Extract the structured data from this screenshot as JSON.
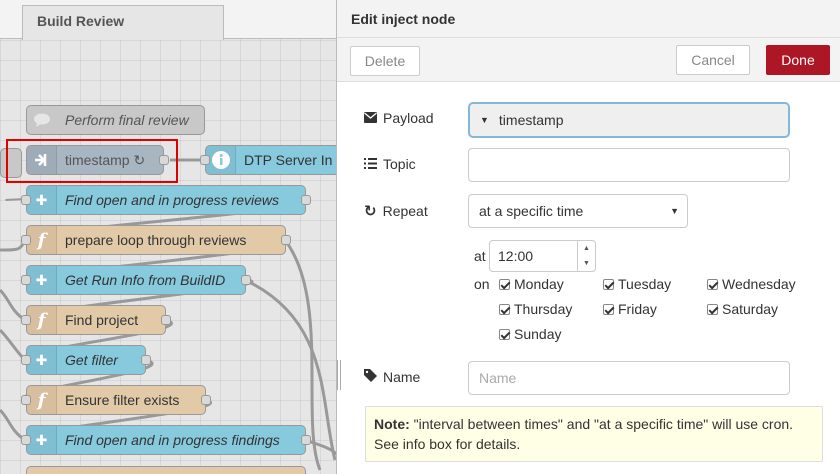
{
  "workspace": {
    "tab_label": "Build Review",
    "nodes": [
      {
        "label": "Perform final review",
        "color": "#c8c8c8",
        "italic": true,
        "icon": "comment-icon"
      },
      {
        "label": "timestamp ↻",
        "color": "#c8c8c8",
        "italic": false,
        "icon": "inject-arrow-icon"
      },
      {
        "label": "DTP Server In",
        "color": "#87c9dd",
        "italic": false,
        "icon": "info-icon"
      },
      {
        "label": "Find open and in progress reviews",
        "color": "#87c9dd",
        "italic": true,
        "icon": "puzzle-icon"
      },
      {
        "label": "prepare loop through reviews",
        "color": "#e2c9a7",
        "italic": false,
        "icon": "function-icon"
      },
      {
        "label": "Get Run Info from BuildID",
        "color": "#87c9dd",
        "italic": true,
        "icon": "puzzle-icon"
      },
      {
        "label": "Find project",
        "color": "#e2c9a7",
        "italic": false,
        "icon": "function-icon"
      },
      {
        "label": "Get filter",
        "color": "#87c9dd",
        "italic": true,
        "icon": "puzzle-icon"
      },
      {
        "label": "Ensure filter exists",
        "color": "#e2c9a7",
        "italic": false,
        "icon": "function-icon"
      },
      {
        "label": "Find open and in progress findings",
        "color": "#87c9dd",
        "italic": true,
        "icon": "puzzle-icon"
      }
    ]
  },
  "tray": {
    "title": "Edit inject node",
    "delete_label": "Delete",
    "cancel_label": "Cancel",
    "done_label": "Done",
    "payload_label": "Payload",
    "payload_value": "timestamp",
    "topic_label": "Topic",
    "topic_value": "",
    "repeat_label": "Repeat",
    "repeat_value": "at a specific time",
    "at_label": "at",
    "time_value": "12:00",
    "on_label": "on",
    "days": [
      "Monday",
      "Tuesday",
      "Wednesday",
      "Thursday",
      "Friday",
      "Saturday",
      "Sunday"
    ],
    "name_label": "Name",
    "name_placeholder": "Name",
    "note_bold": "Note:",
    "note_text": " \"interval between times\" and \"at a specific time\" will use cron. See info box for details."
  },
  "colors": {
    "done_button": "#ad1625",
    "highlight_box": "#e00000",
    "node_blue": "#87c9dd",
    "node_tan": "#e2c9a7",
    "node_grey": "#c8c8c8"
  }
}
